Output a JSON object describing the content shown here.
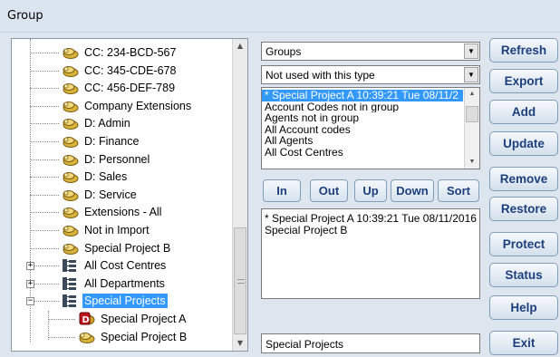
{
  "window": {
    "title": "Group"
  },
  "tree": {
    "items": [
      {
        "label": "CC: 234-BCD-567",
        "icon": "group-folder-icon"
      },
      {
        "label": "CC: 345-CDE-678",
        "icon": "group-folder-icon"
      },
      {
        "label": "CC: 456-DEF-789",
        "icon": "group-folder-icon"
      },
      {
        "label": "Company Extensions",
        "icon": "group-folder-icon"
      },
      {
        "label": "D: Admin",
        "icon": "group-folder-icon"
      },
      {
        "label": "D: Finance",
        "icon": "group-folder-icon"
      },
      {
        "label": "D: Personnel",
        "icon": "group-folder-icon"
      },
      {
        "label": "D: Sales",
        "icon": "group-folder-icon"
      },
      {
        "label": "D: Service",
        "icon": "group-folder-icon"
      },
      {
        "label": "Extensions - All",
        "icon": "group-folder-icon"
      },
      {
        "label": "Not in Import",
        "icon": "group-folder-icon"
      },
      {
        "label": "Special Project B",
        "icon": "group-folder-icon"
      },
      {
        "label": "All Cost Centres",
        "icon": "org-tree-icon",
        "expander": "+"
      },
      {
        "label": "All Departments",
        "icon": "org-tree-icon",
        "expander": "+"
      },
      {
        "label": "Special Projects",
        "icon": "org-tree-icon",
        "expander": "−",
        "selected": true
      },
      {
        "label": "Special Project A",
        "icon": "d-badge-icon"
      },
      {
        "label": "Special Project B",
        "icon": "group-folder-icon"
      }
    ]
  },
  "type_combo": {
    "value": "Groups"
  },
  "filter_combo": {
    "value": "Not used with this type"
  },
  "source_list": {
    "items": [
      {
        "label": "* Special Project A 10:39:21 Tue 08/11/2",
        "selected": true
      },
      {
        "label": "Account Codes not in group"
      },
      {
        "label": "Agents not in group"
      },
      {
        "label": "All Account codes"
      },
      {
        "label": "All Agents"
      },
      {
        "label": "All Cost Centres"
      }
    ]
  },
  "move_buttons": {
    "in": "In",
    "out": "Out",
    "up": "Up",
    "down": "Down",
    "sort": "Sort"
  },
  "members": {
    "lines": [
      "* Special Project A 10:39:21 Tue 08/11/2016",
      "Special Project B"
    ]
  },
  "group_name": {
    "value": "Special Projects"
  },
  "actions": {
    "refresh": "Refresh",
    "export": "Export",
    "add": "Add",
    "update": "Update",
    "remove": "Remove",
    "restore": "Restore",
    "protect": "Protect",
    "status": "Status",
    "help": "Help",
    "exit": "Exit"
  },
  "colors": {
    "selection": "#3399ff",
    "button_text": "#1c3f7d",
    "background": "#dde6ef"
  }
}
